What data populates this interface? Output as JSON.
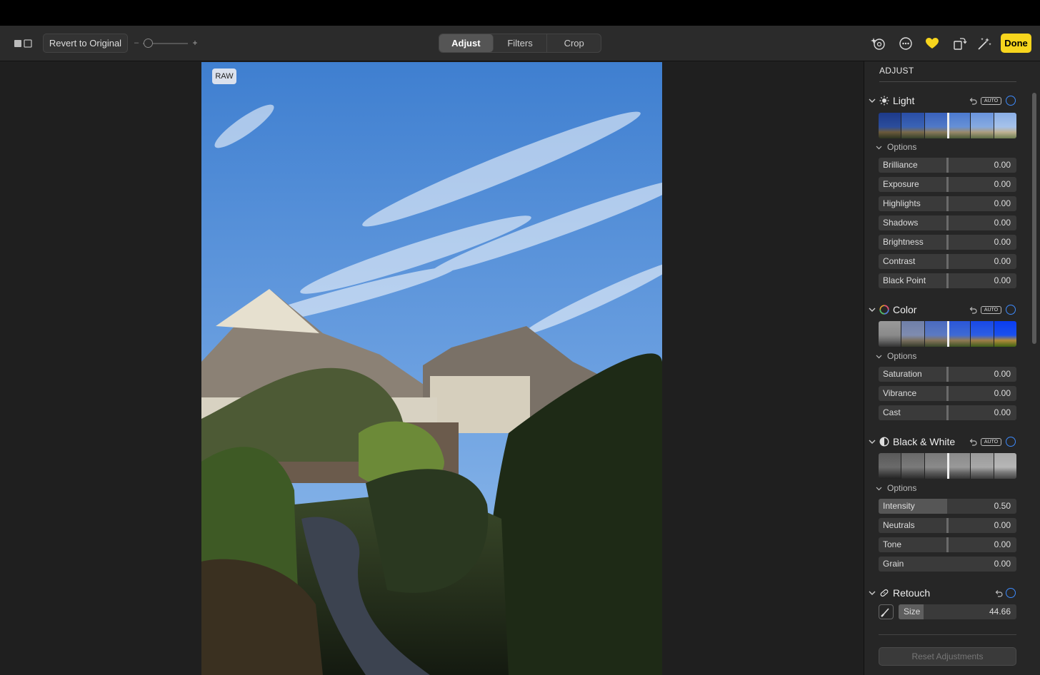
{
  "toolbar": {
    "revert_label": "Revert to Original",
    "zoom_minus": "–",
    "zoom_plus": "+",
    "zoom_level": 0.05,
    "tabs": [
      {
        "label": "Adjust",
        "active": true
      },
      {
        "label": "Filters",
        "active": false
      },
      {
        "label": "Crop",
        "active": false
      }
    ],
    "icons": [
      "side-by-side-icon",
      "enhance-history-icon",
      "more-icon",
      "favorite-heart-icon",
      "rotate-icon",
      "auto-enhance-icon"
    ],
    "done_label": "Done",
    "accent": "#f7d51d"
  },
  "photo": {
    "badge": "RAW"
  },
  "sidebar": {
    "title": "ADJUST",
    "options_label": "Options",
    "auto_label": "AUTO",
    "sections": {
      "light": {
        "label": "Light",
        "sliders": [
          {
            "label": "Brilliance",
            "value": "0.00"
          },
          {
            "label": "Exposure",
            "value": "0.00"
          },
          {
            "label": "Highlights",
            "value": "0.00"
          },
          {
            "label": "Shadows",
            "value": "0.00"
          },
          {
            "label": "Brightness",
            "value": "0.00"
          },
          {
            "label": "Contrast",
            "value": "0.00"
          },
          {
            "label": "Black Point",
            "value": "0.00"
          }
        ]
      },
      "color": {
        "label": "Color",
        "sliders": [
          {
            "label": "Saturation",
            "value": "0.00"
          },
          {
            "label": "Vibrance",
            "value": "0.00"
          },
          {
            "label": "Cast",
            "value": "0.00"
          }
        ]
      },
      "bw": {
        "label": "Black & White",
        "sliders": [
          {
            "label": "Intensity",
            "value": "0.50"
          },
          {
            "label": "Neutrals",
            "value": "0.00"
          },
          {
            "label": "Tone",
            "value": "0.00"
          },
          {
            "label": "Grain",
            "value": "0.00"
          }
        ]
      },
      "retouch": {
        "label": "Retouch",
        "size_label": "Size",
        "size_value": "44.66"
      }
    },
    "reset_label": "Reset Adjustments",
    "toggle_color": "#3d8bfd"
  }
}
